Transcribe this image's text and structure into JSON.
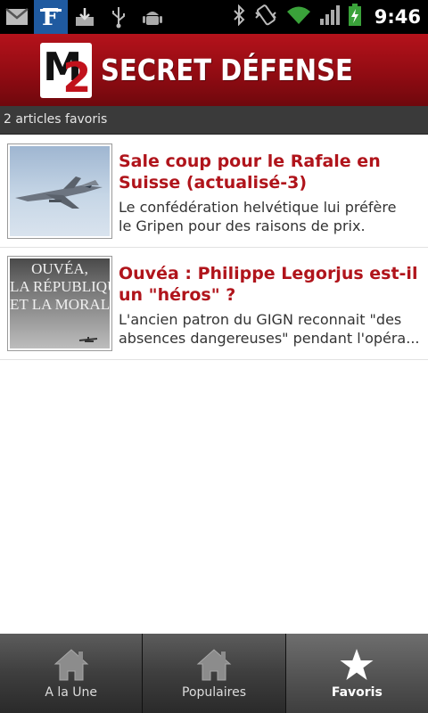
{
  "status_bar": {
    "time": "9:46",
    "left_icons": [
      "gmail-icon",
      "le-figaro-icon",
      "download-icon",
      "usb-icon",
      "android-debug-icon"
    ],
    "right_icons": [
      "bluetooth-icon",
      "vibrate-icon",
      "wifi-icon",
      "signal-icon",
      "battery-charging-icon"
    ]
  },
  "header": {
    "logo_mark": "M2",
    "logo_text": "SECRET DÉFENSE",
    "brand_color": "#b0141b"
  },
  "subheader": {
    "label": "2 articles favoris"
  },
  "articles": [
    {
      "title": "Sale coup pour le Rafale en Suisse (actualisé-3)",
      "desc_line1": "Le confédération helvétique lui préfère",
      "desc_line2": "le Gripen pour des raisons de prix.",
      "thumb": "fighter-jet-photo"
    },
    {
      "title": "Ouvéa : Philippe Legorjus est-il un \"héros\" ?",
      "desc_line1": "L'ancien patron du GIGN reconnait \"des",
      "desc_line2": "absences dangereuses\" pendant l'opéra...",
      "thumb": "ouvea-movie-poster",
      "thumb_text": [
        "OUVÉA,",
        "LA RÉPUBLIQU",
        "ET LA MORAL"
      ]
    }
  ],
  "tabs": [
    {
      "label": "A la Une",
      "icon": "home-icon",
      "active": false
    },
    {
      "label": "Populaires",
      "icon": "home-icon",
      "active": false
    },
    {
      "label": "Favoris",
      "icon": "star-icon",
      "active": true
    }
  ]
}
